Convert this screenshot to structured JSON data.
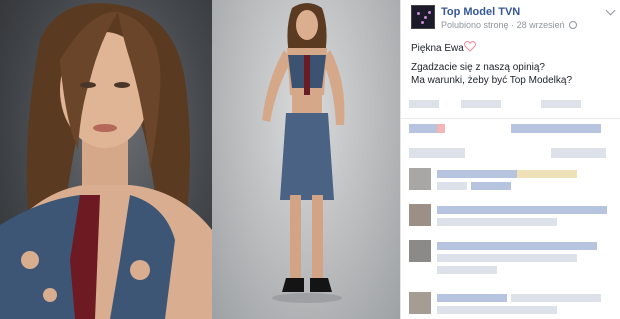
{
  "post": {
    "page_name": "Top Model TVN",
    "liked_label": "Polubiono stronę",
    "separator": "·",
    "date": "28 wrzesień",
    "text_line1": "Piękna Ewa",
    "text_line2": "Zgadzacie się z naszą opinią?",
    "text_line3": "Ma warunki, żeby być Top Modelką?"
  },
  "icons": [
    "page-avatar",
    "globe-icon",
    "chevron-down-icon",
    "heart-icon"
  ],
  "colors": {
    "link": "#365899",
    "meta": "#90949c",
    "text": "#1d2129",
    "heart": "#f4a6b3"
  }
}
